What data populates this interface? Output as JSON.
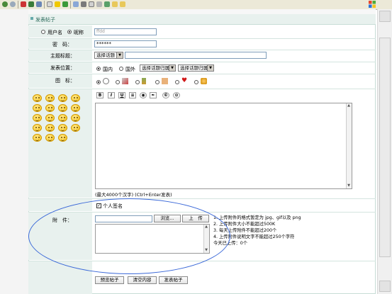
{
  "browser": {
    "toolbar_icons": [
      "back-icon",
      "forward-icon",
      "stop-icon",
      "refresh-icon",
      "home-icon",
      "search-icon",
      "favorites-icon",
      "history-icon",
      "mail-icon",
      "print-icon",
      "edit-icon",
      "discuss-icon",
      "messenger-icon",
      "folder-icon",
      "windows-logo-icon"
    ]
  },
  "form": {
    "header": "发表帖子",
    "user_type": {
      "option_username": "用户名",
      "option_nickname": "昵称",
      "selected": "昵称",
      "value": "ffdd"
    },
    "password": {
      "label": "密　码：",
      "value": "******"
    },
    "subject": {
      "label": "主题标题：",
      "select_value": "选择话题",
      "value": ""
    },
    "location": {
      "label": "发表位置：",
      "option_domestic": "国内",
      "option_abroad": "国外",
      "selected": "国内",
      "select1": "选择话题归属",
      "select2": "选择话题归属"
    },
    "icon_row": {
      "label": "图　标：",
      "icons": [
        "face-icon",
        "rocket-icon",
        "bottle-icon",
        "heart-icon",
        "hand-icon",
        "cup-icon"
      ]
    },
    "editor": {
      "buttons": [
        "B",
        "I",
        "U",
        "≡",
        "◉",
        "✒",
        "©",
        "⊙"
      ],
      "hint": "(最大4000个汉字)   (Ctrl+Enter发表)",
      "emoticon_count": 19
    },
    "signature": {
      "label": "个人签名",
      "checked": true
    },
    "attachment": {
      "label": "附　件：",
      "browse_button": "浏览...",
      "upload_button": "上　传",
      "notes": [
        "1. 上传附件的格式暂定为 jpg、gif以及 png",
        "2. 上传附件大小不能超过500K",
        "3. 每天上传附件不能超过200个",
        "4. 上传附件说明文字不能超过250个字符",
        "今天已上传：0个"
      ]
    },
    "actions": {
      "preview": "预览帖子",
      "clear": "清空内容",
      "submit": "发表帖子"
    },
    "annotation_color": "#3a68d8"
  }
}
